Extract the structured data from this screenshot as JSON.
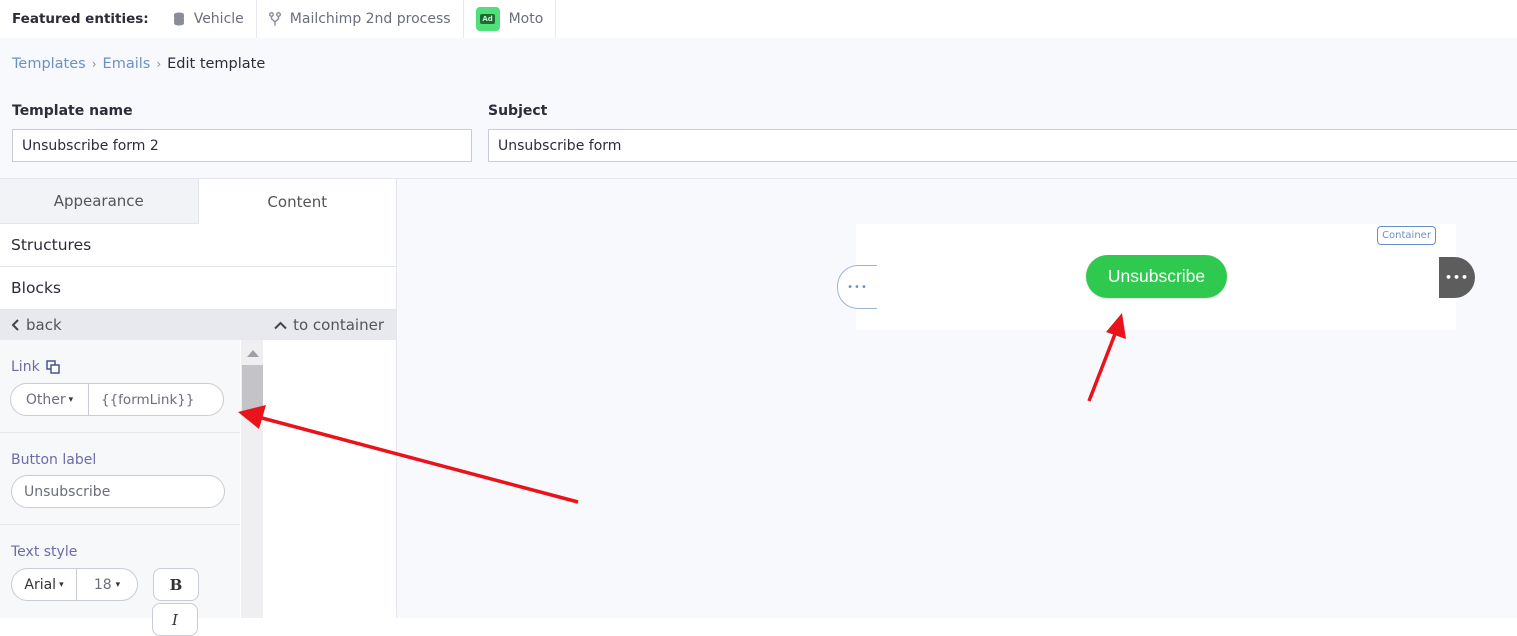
{
  "featured": {
    "label": "Featured entities:",
    "items": [
      {
        "icon": "database-icon",
        "label": "Vehicle"
      },
      {
        "icon": "process-fork-icon",
        "label": "Mailchimp 2nd process"
      },
      {
        "icon": "ad-icon",
        "icon_text": "Ad",
        "label": "Moto"
      }
    ]
  },
  "breadcrumb": {
    "items": [
      "Templates",
      "Emails"
    ],
    "current": "Edit template",
    "separator": "›"
  },
  "form": {
    "template_name_label": "Template name",
    "template_name_value": "Unsubscribe form 2",
    "subject_label": "Subject",
    "subject_value": "Unsubscribe form"
  },
  "editor": {
    "tabs": [
      "Appearance",
      "Content"
    ],
    "active_tab": "Content",
    "sections": [
      "Structures",
      "Blocks"
    ],
    "back_label": "back",
    "to_container_label": "to container",
    "props": {
      "link_label": "Link",
      "link_type": "Other",
      "link_value": "{{formLink}}",
      "button_label_label": "Button label",
      "button_label_value": "Unsubscribe",
      "text_style_label": "Text style",
      "font_family": "Arial",
      "font_size": "18",
      "bold_label": "B",
      "italic_label": "I"
    }
  },
  "canvas": {
    "button_text": "Unsubscribe",
    "button_color": "#2fc94f",
    "container_tag": "Container",
    "handle_dots": "•••"
  },
  "colors": {
    "accent": "#6b90c7",
    "arrow": "#e8131b"
  }
}
